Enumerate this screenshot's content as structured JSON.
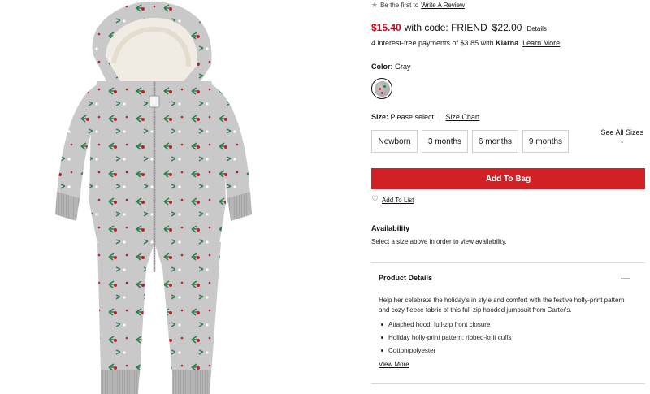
{
  "review": {
    "prefix": "Be the first to",
    "link": "Write A Review",
    "icon": "star-icon"
  },
  "price": {
    "sale": "$15.40",
    "code_text": "with code: FRIEND",
    "original": "$22.00",
    "details_link": "Details"
  },
  "klarna": {
    "prefix": "4 interest-free payments of $3.85 with",
    "brand": "Klarna",
    "learn_more": "Learn More"
  },
  "color": {
    "label": "Color:",
    "value": "Gray"
  },
  "size": {
    "label": "Size:",
    "value": "Please select",
    "separator": "|",
    "chart_link": "Size Chart",
    "options": [
      "Newborn",
      "3 months",
      "6 months",
      "9 months"
    ],
    "see_all": "See All Sizes"
  },
  "actions": {
    "add_to_bag": "Add To Bag",
    "add_to_list": "Add To List"
  },
  "availability": {
    "title": "Availability",
    "text": "Select a size above in order to view availability."
  },
  "product_details": {
    "title": "Product Details",
    "description": "Help her celebrate the holiday's in style and comfort with the festive holly-print pattern and cozy fleece fabric of this full-zip hooded jumpsuit from Carter's.",
    "bullets": [
      "Attached hood; full-zip front closure",
      "Holiday holly-print pattern; ribbed-knit cuffs",
      "Cotton/polyester"
    ],
    "view_more": "View More"
  },
  "colors": {
    "accent": "#d12026",
    "sale": "#d0021b",
    "fabric": "#c7c7c7",
    "holly_leaf": "#2e7d4f",
    "berry": "#c0202a"
  }
}
